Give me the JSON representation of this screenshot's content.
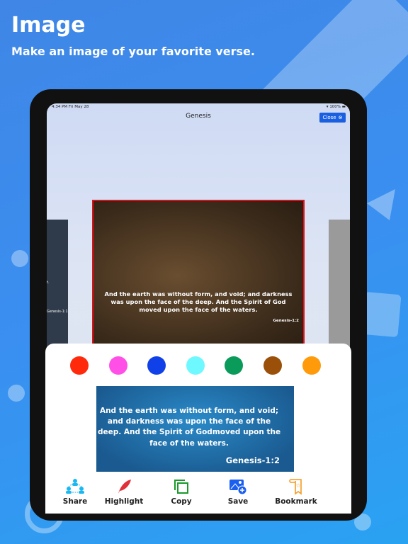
{
  "header": {
    "title": "Image",
    "subtitle": "Make an image of your favorite verse."
  },
  "status": {
    "time": "4:34 PM  Fri May 28",
    "battery": "100%"
  },
  "nav": {
    "title": "Genesis",
    "close_label": "Close"
  },
  "card": {
    "verse": "And the earth was without form, and void; and darkness was upon the face of the deep. And the Spirit of God moved upon the face of the waters.",
    "reference": "Genesis-1:2"
  },
  "left_card": {
    "text": "t.",
    "reference": "Genesis-1:1"
  },
  "colors": [
    "#ff2a0c",
    "#ff4fe6",
    "#1040e8",
    "#6ef8ff",
    "#0a9a5a",
    "#9a5008",
    "#ff9a0a"
  ],
  "preview": {
    "verse": "And the earth was without form, and void; and darkness was upon the face of the deep. And the Spirit of Godmoved upon the face of the waters.",
    "reference": "Genesis-1:2"
  },
  "actions": [
    {
      "label": "Share",
      "icon": "share-icon",
      "color": "#1ab8f0"
    },
    {
      "label": "Highlight",
      "icon": "feather-icon",
      "color": "#e0303a"
    },
    {
      "label": "Copy",
      "icon": "copy-icon",
      "color": "#1a9a2a"
    },
    {
      "label": "Save",
      "icon": "save-image-icon",
      "color": "#1a5ff0"
    },
    {
      "label": "Bookmark",
      "icon": "bookmark-icon",
      "color": "#f59a20"
    }
  ]
}
